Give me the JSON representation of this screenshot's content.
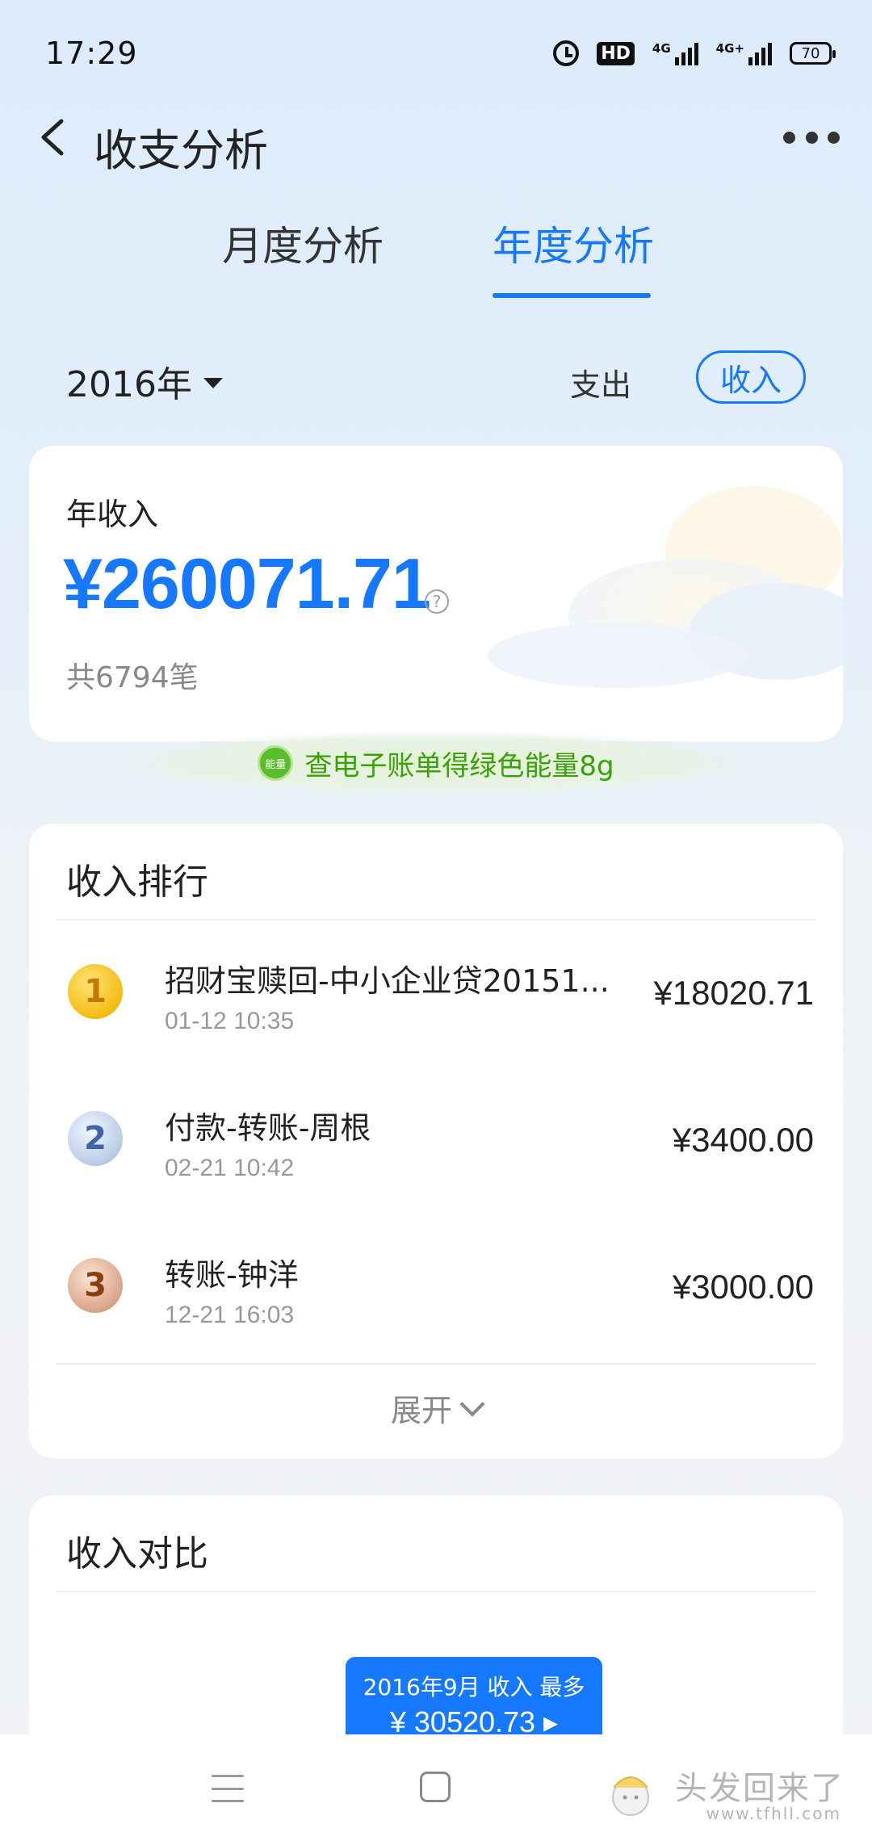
{
  "status_bar": {
    "time": "17:29",
    "hd_label": "HD",
    "signal1_label": "4G",
    "signal2_label": "4G+",
    "battery": "70"
  },
  "header": {
    "title": "收支分析"
  },
  "tabs": [
    {
      "label": "月度分析",
      "active": false
    },
    {
      "label": "年度分析",
      "active": true
    }
  ],
  "filter": {
    "year": "2016年",
    "expense_label": "支出",
    "income_label": "收入"
  },
  "summary": {
    "label": "年收入",
    "amount": "¥260071.71",
    "count": "共6794笔",
    "help_glyph": "?"
  },
  "energy_banner": {
    "icon_label": "能量",
    "text": "查电子账单得绿色能量8g"
  },
  "ranking": {
    "title": "收入排行",
    "items": [
      {
        "rank": "1",
        "name": "招财宝赎回-中小企业贷20151...",
        "date": "01-12 10:35",
        "amount": "¥18020.71"
      },
      {
        "rank": "2",
        "name": "付款-转账-周根",
        "date": "02-21 10:42",
        "amount": "¥3400.00"
      },
      {
        "rank": "3",
        "name": "转账-钟洋",
        "date": "12-21 16:03",
        "amount": "¥3000.00"
      }
    ],
    "expand_label": "展开"
  },
  "compare": {
    "title": "收入对比",
    "tooltip_line1": "2016年9月 收入 最多",
    "tooltip_line2": "¥ 30520.73 ▸"
  },
  "watermark": {
    "text": "头发回来了",
    "url": "www.tfhll.com"
  },
  "colors": {
    "accent": "#1677ff",
    "energy_green": "#3aa10b"
  }
}
